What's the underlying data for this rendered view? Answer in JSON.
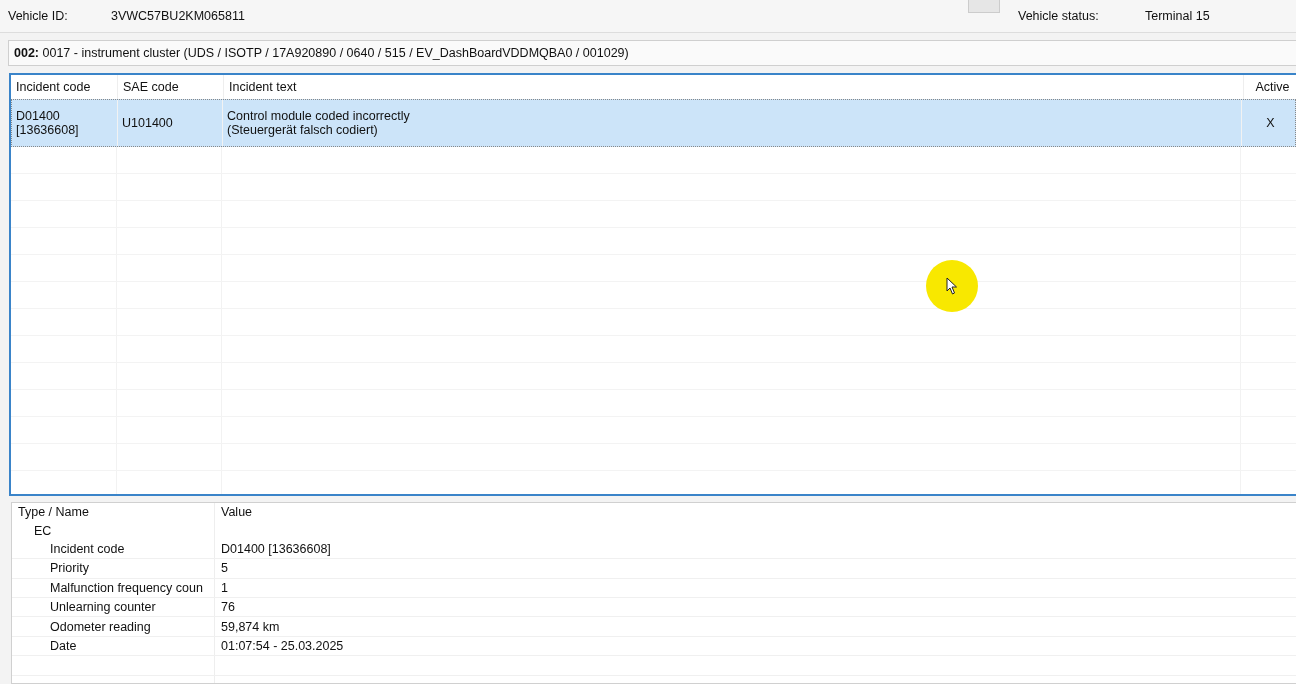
{
  "header": {
    "vehicle_id_label": "Vehicle ID:",
    "vehicle_id": "3VWC57BU2KM065811",
    "vehicle_status_label": "Vehicle status:",
    "vehicle_status": "Terminal 15"
  },
  "module": {
    "number": "002:",
    "description": "0017 - instrument cluster  (UDS / ISOTP / 17A920890 / 0640 / 515 / EV_DashBoardVDDMQBA0 / 001029)"
  },
  "incidents": {
    "columns": [
      "Incident code",
      "SAE code",
      "Incident text",
      "Active"
    ],
    "rows": [
      {
        "incident_code": [
          "D01400",
          "[13636608]"
        ],
        "sae_code": "U101400",
        "incident_text": [
          "Control module coded incorrectly",
          "(Steuergerät falsch codiert)"
        ],
        "active": "X",
        "selected": true
      }
    ]
  },
  "details": {
    "columns": [
      "Type / Name",
      "Value"
    ],
    "rows": [
      {
        "name": "EC",
        "value": "",
        "children": [
          {
            "name": "Incident code",
            "value": "D01400 [13636608]"
          },
          {
            "name": "Priority",
            "value": "5"
          },
          {
            "name": "Malfunction frequency coun",
            "value": "1"
          },
          {
            "name": "Unlearning counter",
            "value": "76"
          },
          {
            "name": "Odometer reading",
            "value": "59,874 km"
          },
          {
            "name": "Date",
            "value": "01:07:54 - 25.03.2025"
          }
        ]
      }
    ]
  }
}
